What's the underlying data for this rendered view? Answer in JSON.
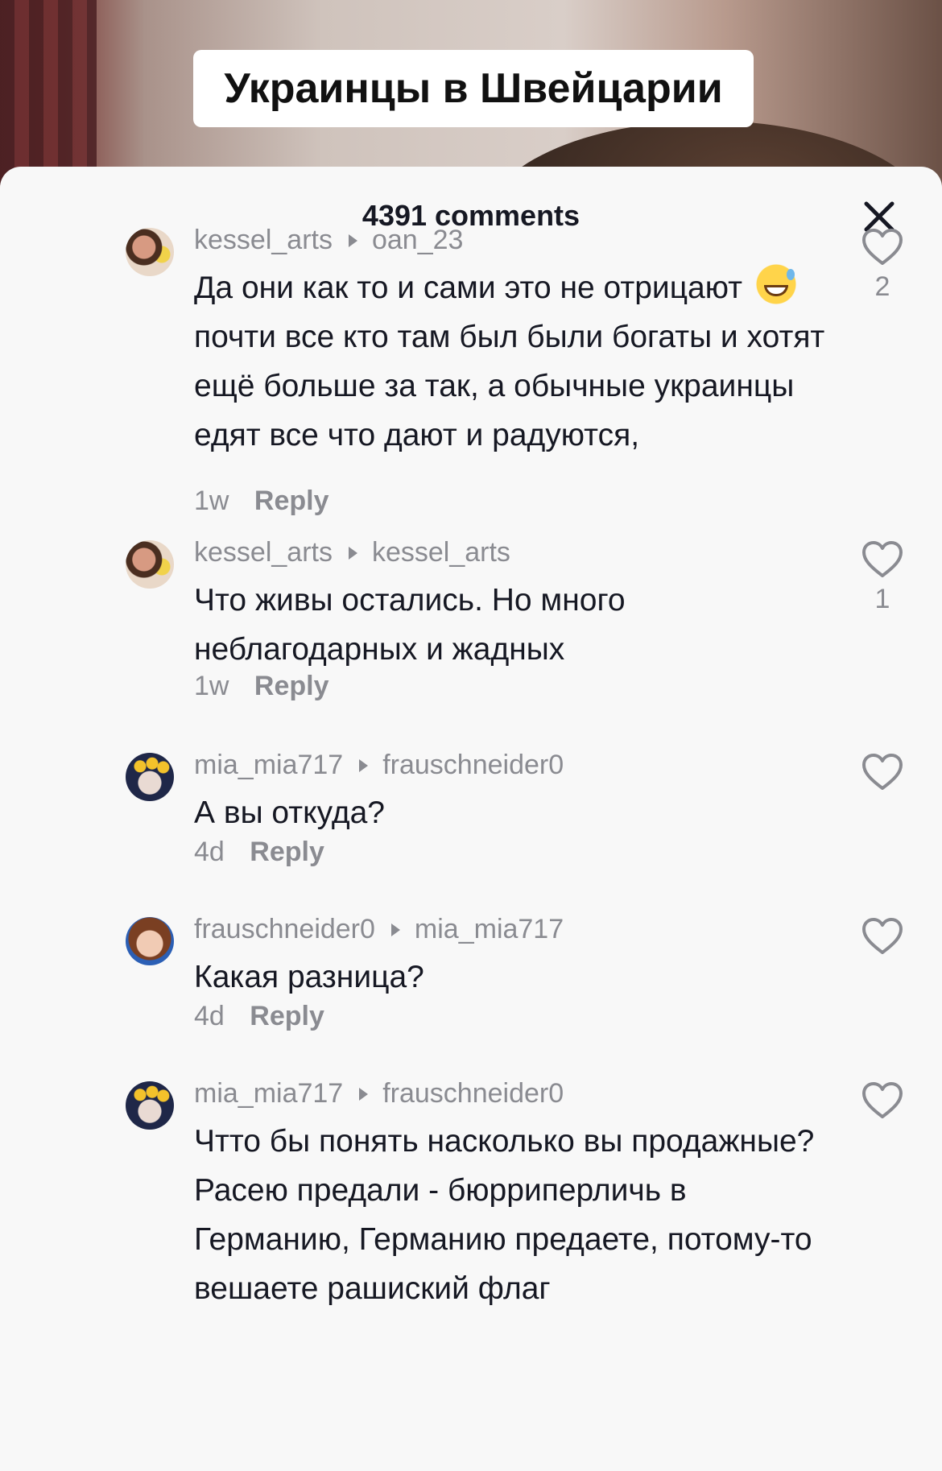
{
  "video": {
    "caption": "Украинцы в Швейцарии"
  },
  "panel": {
    "title": "4391 comments",
    "close_icon": "close-icon"
  },
  "comments": [
    {
      "author": "kessel_arts",
      "reply_to": "oan_23",
      "text": "Да они как то и сами это не отрицают",
      "emoji": "grinning-face-with-sweat",
      "text2": "почти все кто там был были богаты и хотят ещё больше за так, а обычные украинцы едят все что дают и радуются,",
      "age": "1w",
      "reply": "Reply",
      "likes": "2"
    },
    {
      "author": "kessel_arts",
      "reply_to": "kessel_arts",
      "text": "Что живы остались. Но много неблагодарных и жадных",
      "age": "1w",
      "reply": "Reply",
      "likes": "1"
    },
    {
      "author": "mia_mia717",
      "reply_to": "frauschneider0",
      "text": "А вы откуда?",
      "age": "4d",
      "reply": "Reply"
    },
    {
      "author": "frauschneider0",
      "reply_to": "mia_mia717",
      "text": "Какая разница?",
      "age": "4d",
      "reply": "Reply"
    },
    {
      "author": "mia_mia717",
      "reply_to": "frauschneider0",
      "text": "Чтто бы понять насколько вы продажные? Расею предали - бюрриперличь в Германию, Германию предаете, потому-то вешаете рашиский флаг"
    }
  ]
}
